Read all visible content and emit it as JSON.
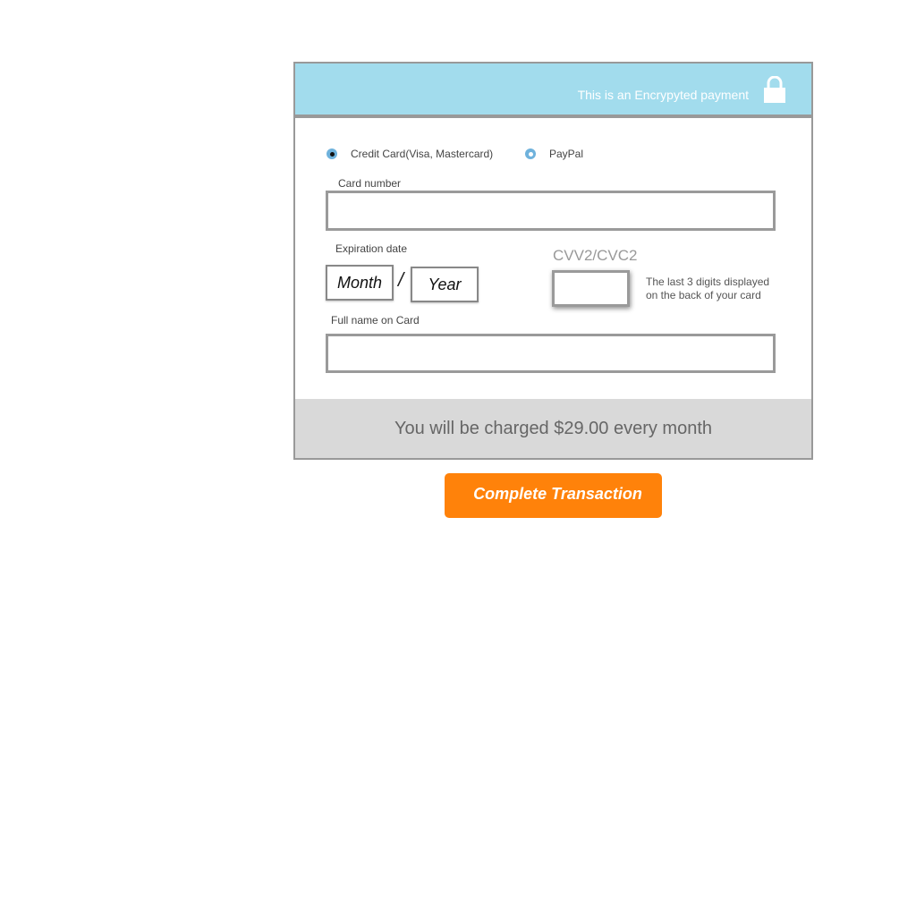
{
  "banner": {
    "text": "This is an Encrypyted payment",
    "lock_icon": "lock-icon",
    "background_color": "#a2dced"
  },
  "payment_methods": [
    {
      "label": "Credit Card(Visa, Mastercard)",
      "selected": true
    },
    {
      "label": "PayPal",
      "selected": false
    }
  ],
  "card_number": {
    "label": "Card number",
    "value": "",
    "placeholder": ""
  },
  "expiration": {
    "label": "Expiration date",
    "month_label": "Month",
    "separator": "/",
    "year_label": "Year"
  },
  "cvv": {
    "title": "CVV2/CVC2",
    "value": "",
    "help_text": "The last 3 digits displayed on the back of your card"
  },
  "full_name": {
    "label": "Full name on Card",
    "value": "",
    "placeholder": ""
  },
  "charge": {
    "text": "You will be charged $29.00 every month"
  },
  "complete_button": {
    "label": "Complete Transaction",
    "color": "#ff820a"
  }
}
